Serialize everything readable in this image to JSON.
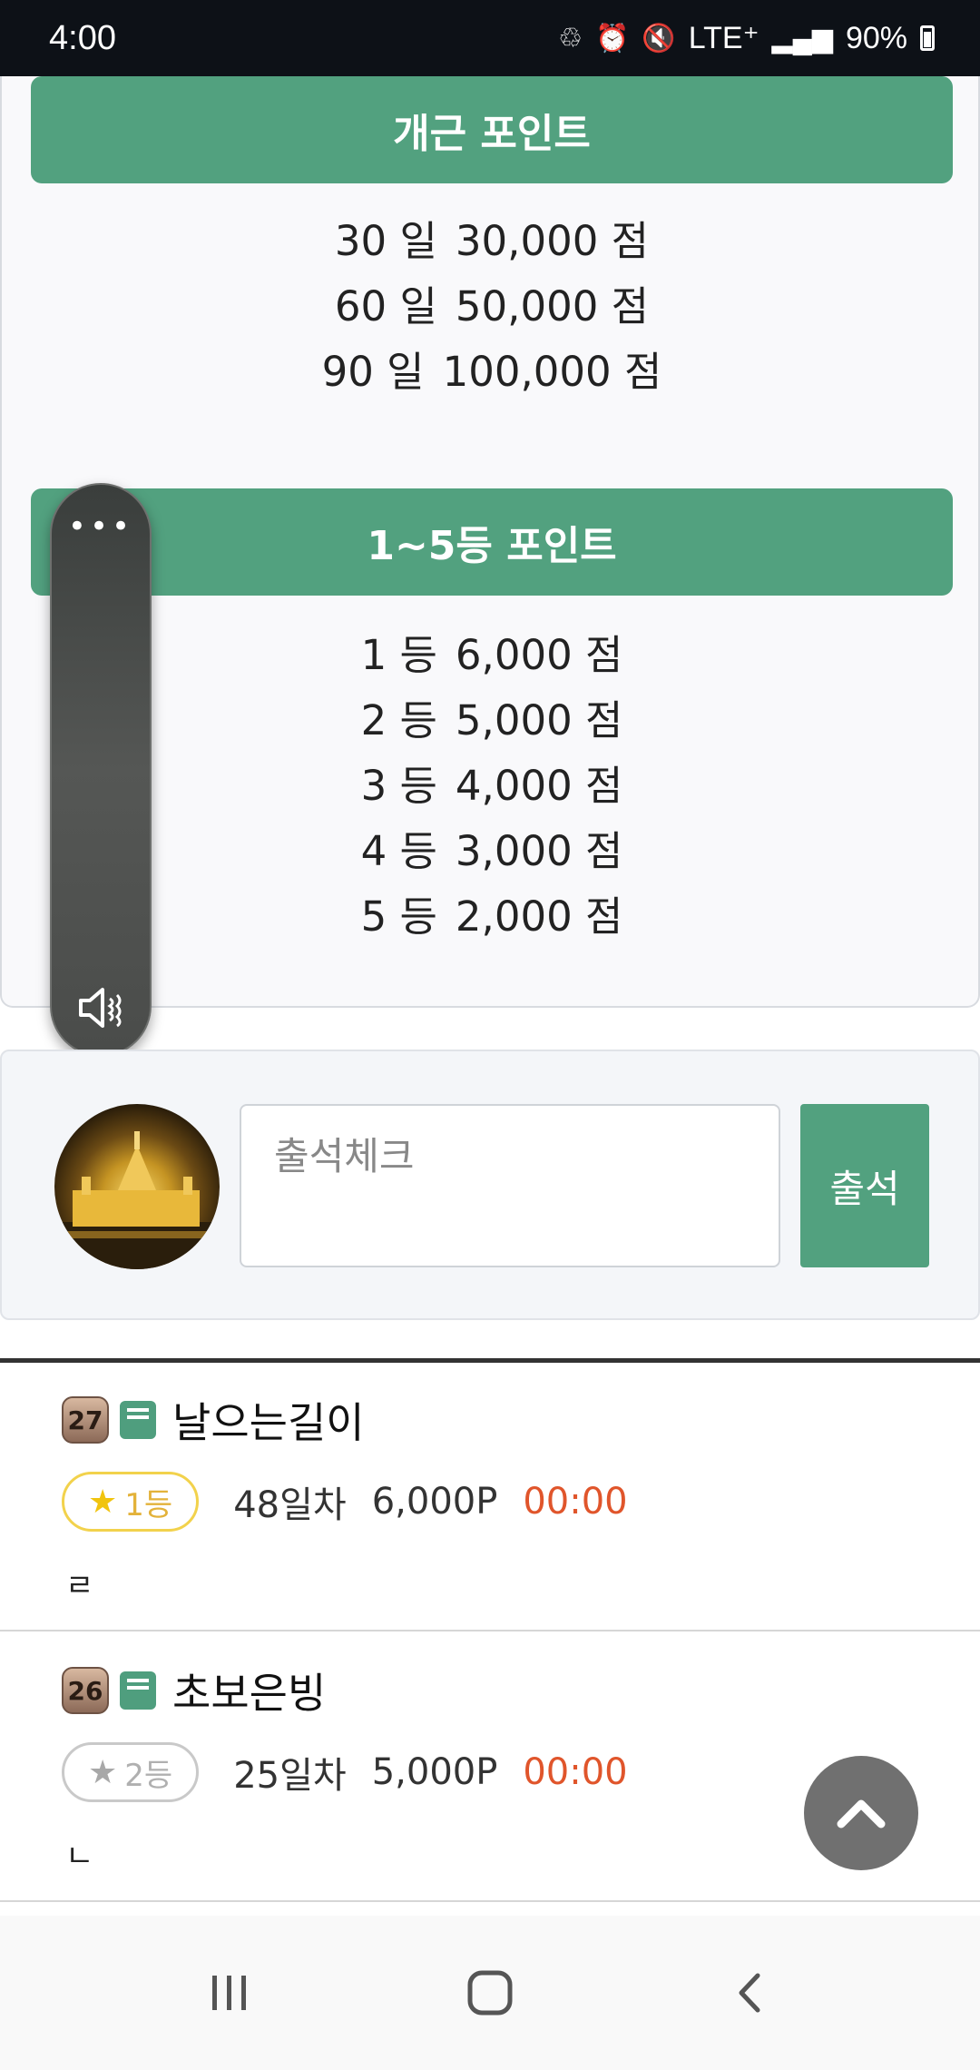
{
  "status_bar": {
    "time": "4:00",
    "network": "LTE⁺",
    "battery": "90%"
  },
  "points_card": {
    "attendance_section": {
      "title": "개근 포인트",
      "rows": [
        {
          "days": "30 일",
          "points": "30,000 점"
        },
        {
          "days": "60 일",
          "points": "50,000 점"
        },
        {
          "days": "90 일",
          "points": "100,000 점"
        }
      ]
    },
    "rank_section": {
      "title": "1~5등 포인트",
      "rows": [
        {
          "rank": "1 등",
          "points": "6,000 점"
        },
        {
          "rank": "2 등",
          "points": "5,000 점"
        },
        {
          "rank": "3 등",
          "points": "4,000 점"
        },
        {
          "rank": "4 등",
          "points": "3,000 점"
        },
        {
          "rank": "5 등",
          "points": "2,000 점"
        }
      ]
    }
  },
  "volume_panel": {
    "dots": "•••",
    "mute_icon": "volume-mute-icon"
  },
  "attendance_form": {
    "placeholder": "출석체크",
    "submit_label": "출석"
  },
  "entries": [
    {
      "level": "27",
      "name": "날으는길이",
      "rank": "1등",
      "days": "48일차",
      "points": "6,000P",
      "time": "00:00",
      "comment": "ㄹ",
      "medal": "gold"
    },
    {
      "level": "26",
      "name": "초보은빙",
      "rank": "2등",
      "days": "25일차",
      "points": "5,000P",
      "time": "00:00",
      "comment": "ㄴ",
      "medal": "silver"
    }
  ],
  "colors": {
    "accent_green": "#52a17f",
    "time_orange": "#e0552b",
    "gold": "#f2d24c"
  }
}
